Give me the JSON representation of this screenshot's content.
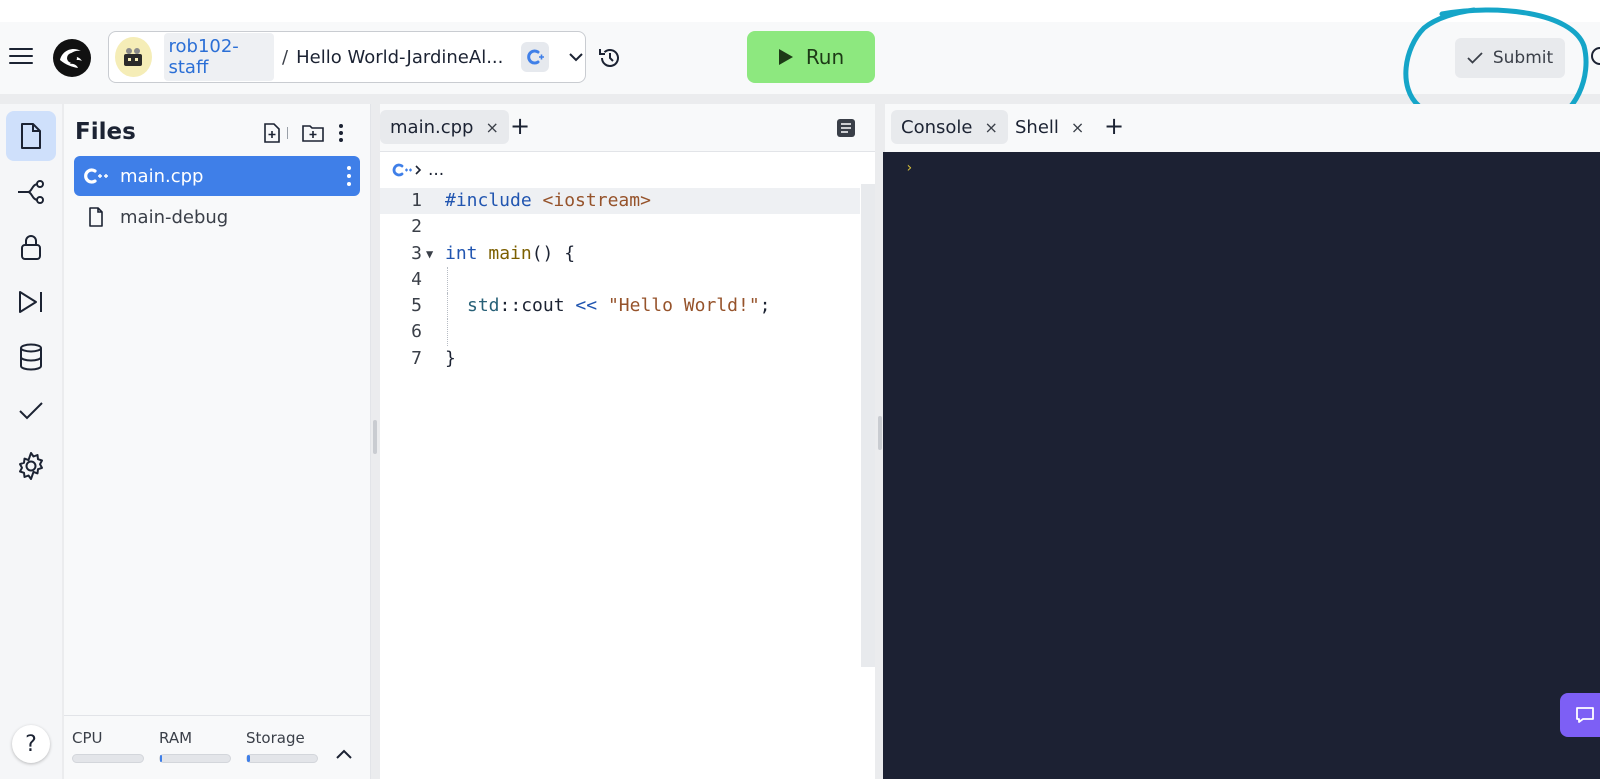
{
  "header": {
    "owner": "rob102-staff",
    "separator": "/",
    "repl_name": "Hello World-JardineAl...",
    "run_label": "Run",
    "submit_label": "Submit"
  },
  "left_nav": {
    "items": [
      "files-icon",
      "git-branch-icon",
      "lock-icon",
      "debugger-icon",
      "database-icon",
      "check-icon",
      "settings-icon"
    ],
    "help_label": "?"
  },
  "files": {
    "title": "Files",
    "items": [
      {
        "name": "main.cpp",
        "icon": "cpp-icon",
        "selected": true
      },
      {
        "name": "main-debug",
        "icon": "file-icon",
        "selected": false
      }
    ],
    "resources": {
      "cpu_label": "CPU",
      "ram_label": "RAM",
      "storage_label": "Storage",
      "cpu_fill": 0.0,
      "ram_fill": 0.03,
      "storage_fill": 0.04
    }
  },
  "editor": {
    "tab_label": "main.cpp",
    "tab_close": "×",
    "add_tab": "+",
    "breadcrumb": "...",
    "lines": [
      {
        "n": "1"
      },
      {
        "n": "2"
      },
      {
        "n": "3"
      },
      {
        "n": "4"
      },
      {
        "n": "5"
      },
      {
        "n": "6"
      },
      {
        "n": "7"
      }
    ],
    "code": {
      "l1_kw": "#include",
      "l1_str": "<iostream>",
      "l3_kw": "int",
      "l3_fn": "main",
      "l3_rest": "() {",
      "l5_ns": "std",
      "l5_sep": "::",
      "l5_id": "cout",
      "l5_op": "<<",
      "l5_str": "\"Hello World!\"",
      "l5_end": ";",
      "l7": "}"
    },
    "fold_marker": "▼"
  },
  "console": {
    "tabs": [
      {
        "label": "Console",
        "close": "×"
      },
      {
        "label": "Shell",
        "close": "×"
      }
    ],
    "add_tab": "+",
    "prompt": "›"
  },
  "colors": {
    "run_button": "#8de87f",
    "selected_file": "#3f7fe8",
    "console_bg": "#1c2133",
    "annotation_circle": "#15a5c8",
    "chat_button": "#7d5ff5"
  }
}
